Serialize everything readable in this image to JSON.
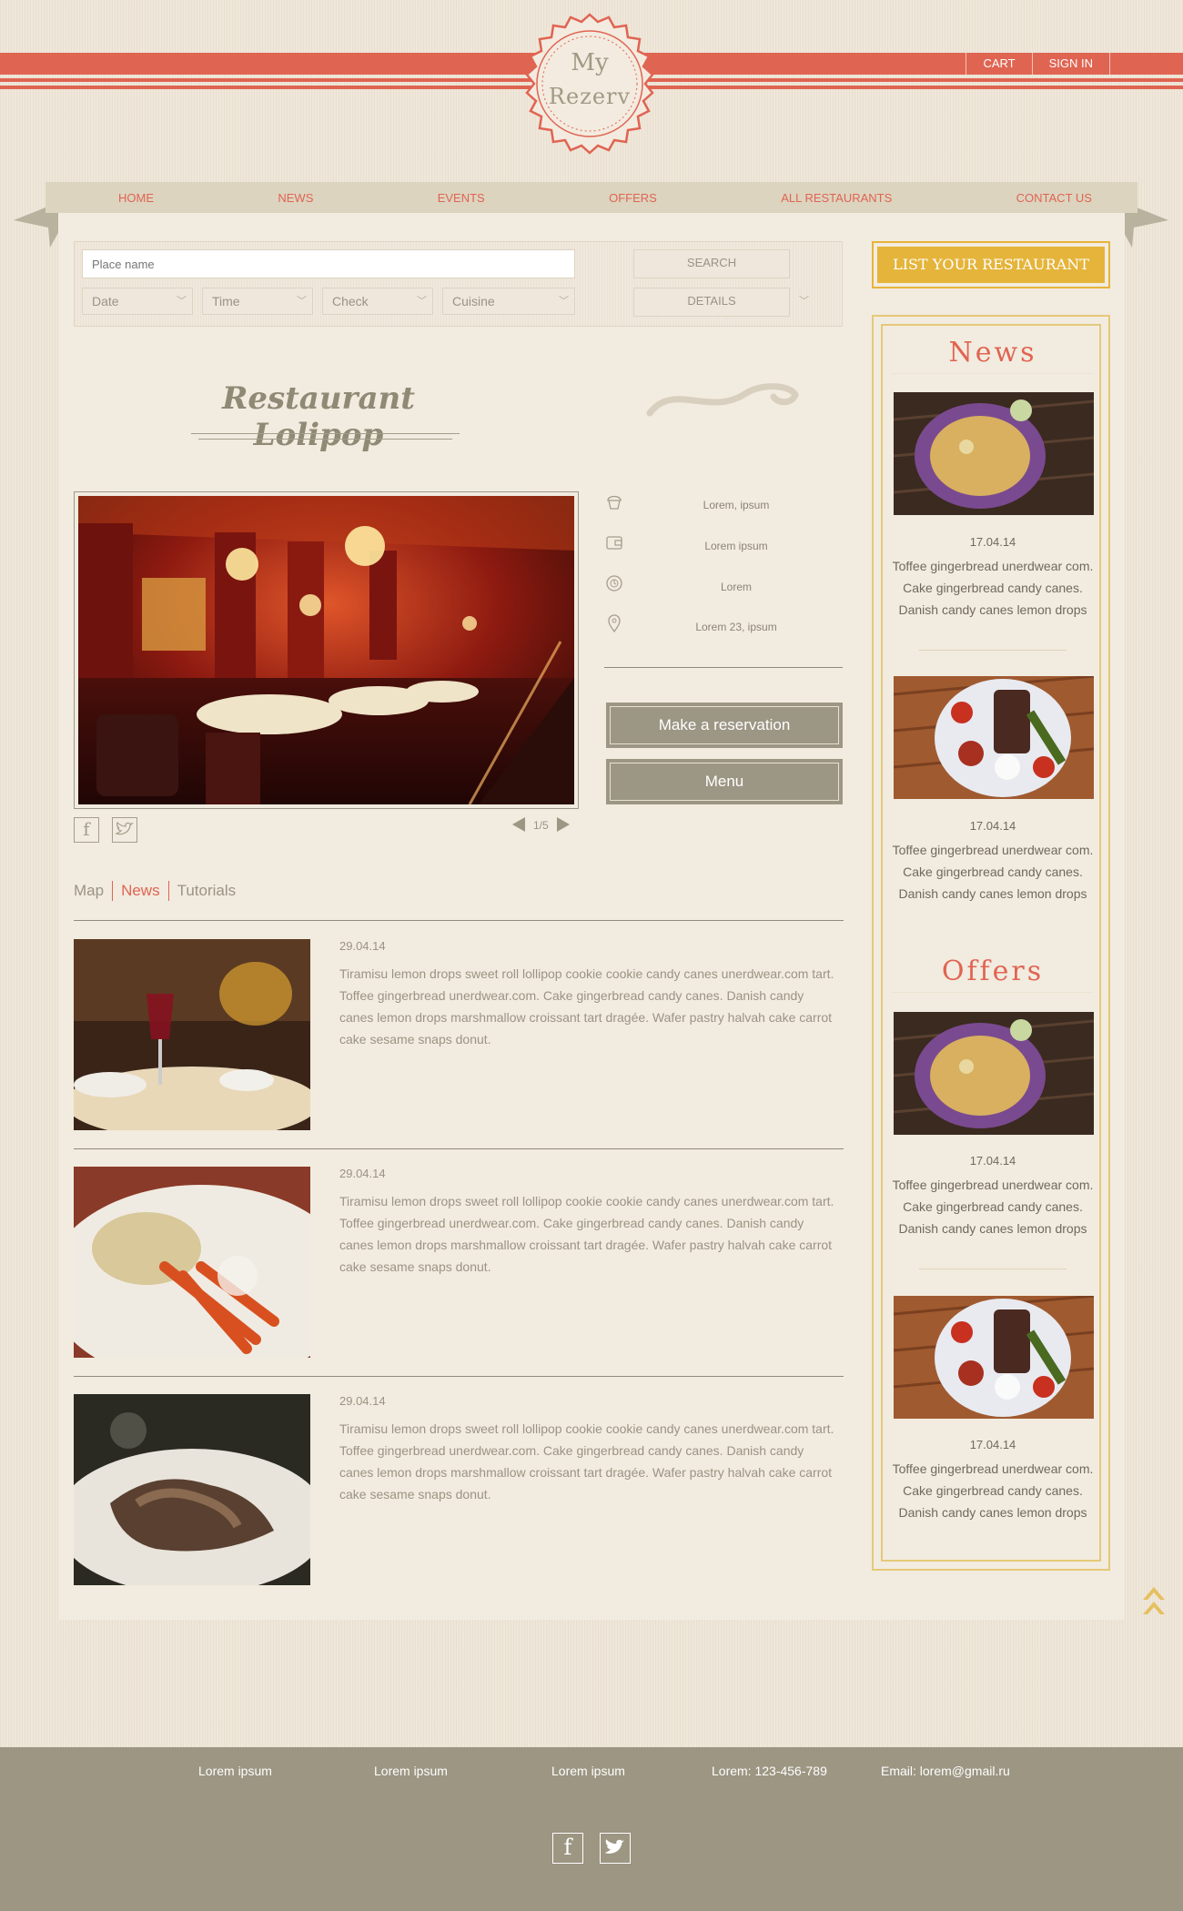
{
  "header": {
    "logo_text_top": "My",
    "logo_text_bottom": "Rezerv",
    "links": [
      "CART",
      "SIGN IN"
    ]
  },
  "nav": [
    "HOME",
    "NEWS",
    "EVENTS",
    "OFFERS",
    "ALL RESTAURANTS",
    "CONTACT US"
  ],
  "search": {
    "place_placeholder": "Place name",
    "selects": [
      "Date",
      "Time",
      "Check",
      "Cuisine"
    ],
    "search_label": "SEARCH",
    "details_label": "DETAILS"
  },
  "restaurant": {
    "title": "Restaurant Lolipop",
    "counter": "1/5",
    "info": [
      "Lorem, ipsum",
      "Lorem ipsum",
      "Lorem",
      "Lorem 23, ipsum"
    ],
    "reserve_label": "Make a reservation",
    "menu_label": "Menu"
  },
  "tabs": [
    "Map",
    "News",
    "Tutorials"
  ],
  "news": [
    {
      "date": "29.04.14",
      "text": "Tiramisu lemon drops sweet roll lollipop cookie cookie candy canes unerdwear.com tart. Toffee gingerbread unerdwear.com. Cake gingerbread candy canes. Danish candy canes lemon drops marshmallow croissant tart dragée. Wafer pastry halvah cake carrot cake sesame snaps donut."
    },
    {
      "date": "29.04.14",
      "text": "Tiramisu lemon drops sweet roll lollipop cookie cookie candy canes unerdwear.com tart. Toffee gingerbread unerdwear.com. Cake gingerbread candy canes. Danish candy canes lemon drops marshmallow croissant tart dragée. Wafer pastry halvah cake carrot cake sesame snaps donut."
    },
    {
      "date": "29.04.14",
      "text": "Tiramisu lemon drops sweet roll lollipop cookie cookie candy canes unerdwear.com tart. Toffee gingerbread unerdwear.com. Cake gingerbread candy canes. Danish candy canes lemon drops marshmallow croissant tart dragée. Wafer pastry halvah cake carrot cake sesame snaps donut."
    }
  ],
  "sidebar": {
    "list_button": "LIST YOUR RESTAURANT",
    "news_heading": "News",
    "offers_heading": "Offers",
    "news": [
      {
        "date": "17.04.14",
        "text": "Toffee gingerbread unerdwear com. Cake gingerbread candy canes. Danish candy canes lemon drops"
      },
      {
        "date": "17.04.14",
        "text": "Toffee gingerbread unerdwear com. Cake gingerbread candy canes. Danish candy canes lemon drops"
      }
    ],
    "offers": [
      {
        "date": "17.04.14",
        "text": "Toffee gingerbread unerdwear com. Cake gingerbread candy canes. Danish candy canes lemon drops"
      },
      {
        "date": "17.04.14",
        "text": "Toffee gingerbread unerdwear com. Cake gingerbread candy canes. Danish candy canes lemon drops"
      }
    ]
  },
  "footer": {
    "items": [
      "Lorem ipsum",
      "Lorem ipsum",
      "Lorem ipsum",
      "Lorem: 123-456-789",
      "Email: lorem@gmail.ru"
    ]
  },
  "colors": {
    "accent": "#e06452",
    "gold": "#e5b43a",
    "muted": "#9c9684"
  }
}
